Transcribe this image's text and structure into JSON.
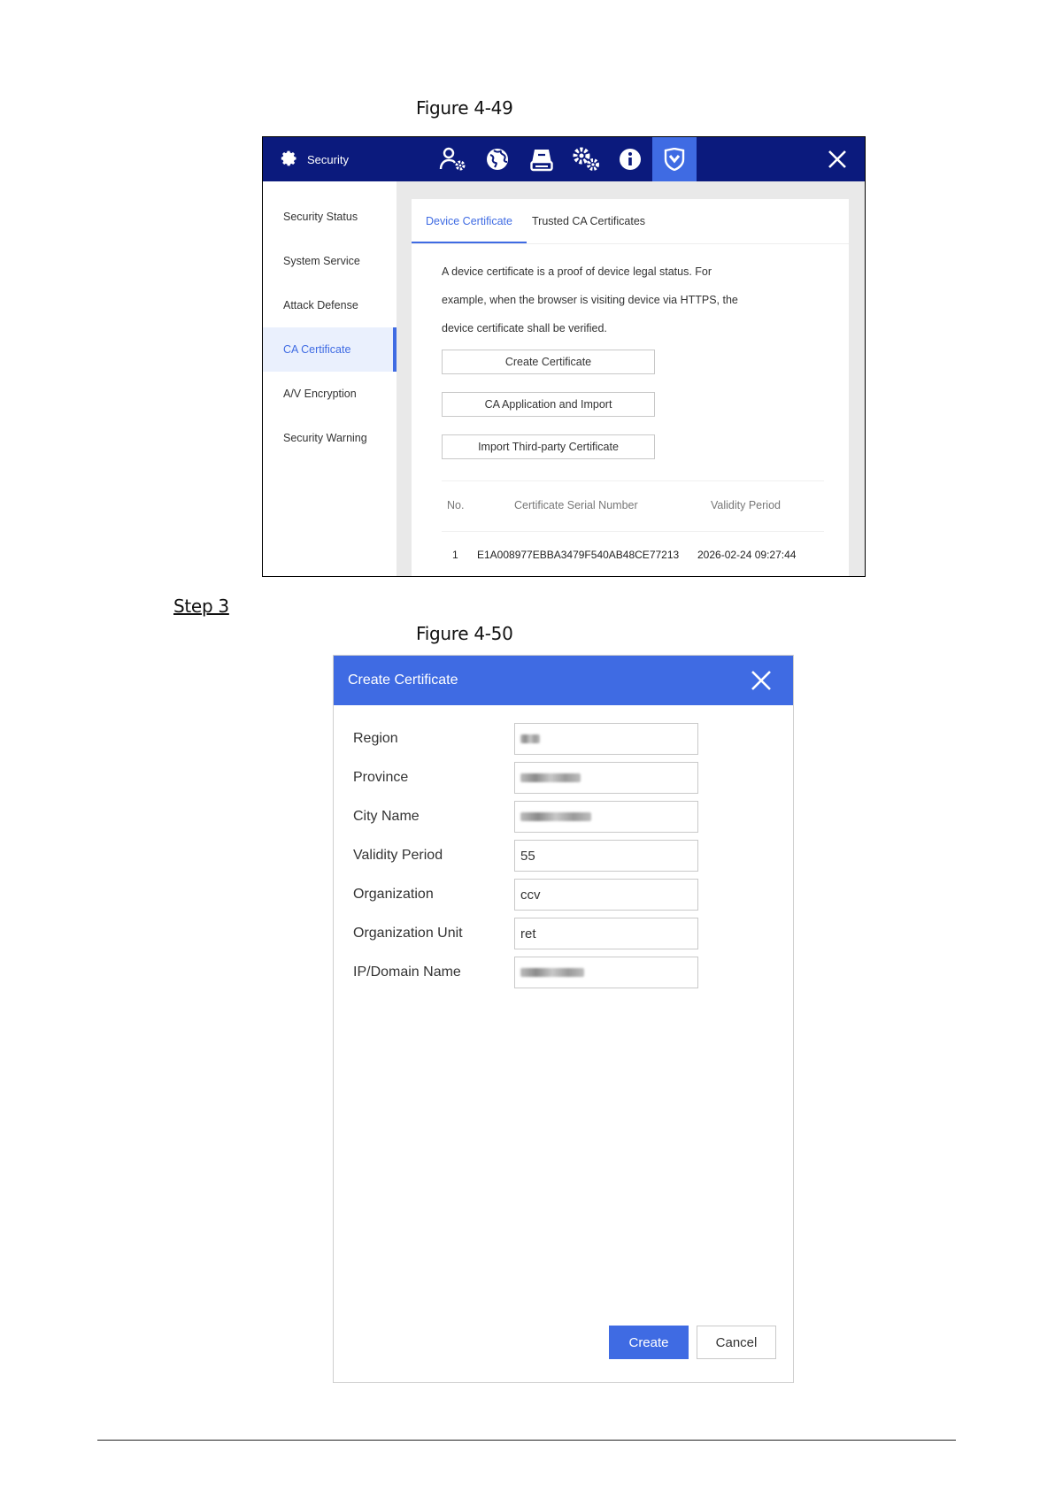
{
  "doc": {
    "figure1_caption": "Figure 4-49",
    "step_label": "Step 3",
    "figure2_caption": "Figure 4-50"
  },
  "security_window": {
    "title": "Security",
    "title_icon": "gear-icon",
    "toolbar_icons": [
      "user-settings-icon",
      "network-globe-icon",
      "storage-icon",
      "system-settings-icon",
      "info-icon",
      "security-shield-icon"
    ],
    "active_toolbar_icon": "security-shield-icon",
    "accent_color": "#3f6be3",
    "topbar_color": "#0b1a7d",
    "sidebar": {
      "items": [
        {
          "label": "Security Status"
        },
        {
          "label": "System Service"
        },
        {
          "label": "Attack Defense"
        },
        {
          "label": "CA Certificate",
          "active": true
        },
        {
          "label": "A/V Encryption"
        },
        {
          "label": "Security Warning"
        }
      ]
    },
    "tabs": [
      {
        "label": "Device Certificate",
        "active": true
      },
      {
        "label": "Trusted CA Certificates"
      }
    ],
    "description": {
      "line1": "A device certificate is a proof of device legal status. For",
      "line2": "example, when the browser is visiting device via HTTPS, the",
      "line3": "device certificate shall be verified."
    },
    "buttons": {
      "create": "Create Certificate",
      "ca_import": "CA Application and Import",
      "third_party": "Import Third-party Certificate"
    },
    "table": {
      "headers": [
        "No.",
        "Certificate Serial Number",
        "Validity Period"
      ],
      "rows": [
        {
          "no": "1",
          "serial": "E1A008977EBBA3479F540AB48CE77213",
          "validity": "2026-02-24 09:27:44"
        }
      ]
    }
  },
  "create_dialog": {
    "title": "Create Certificate",
    "fields": [
      {
        "label": "Region",
        "value": "",
        "blurred": true
      },
      {
        "label": "Province",
        "value": "",
        "blurred": true
      },
      {
        "label": "City Name",
        "value": "",
        "blurred": true
      },
      {
        "label": "Validity Period",
        "value": "55"
      },
      {
        "label": "Organization",
        "value": "ccv"
      },
      {
        "label": "Organization Unit",
        "value": "ret"
      },
      {
        "label": "IP/Domain Name",
        "value": "",
        "blurred": true
      }
    ],
    "create_button": "Create",
    "cancel_button": "Cancel"
  }
}
